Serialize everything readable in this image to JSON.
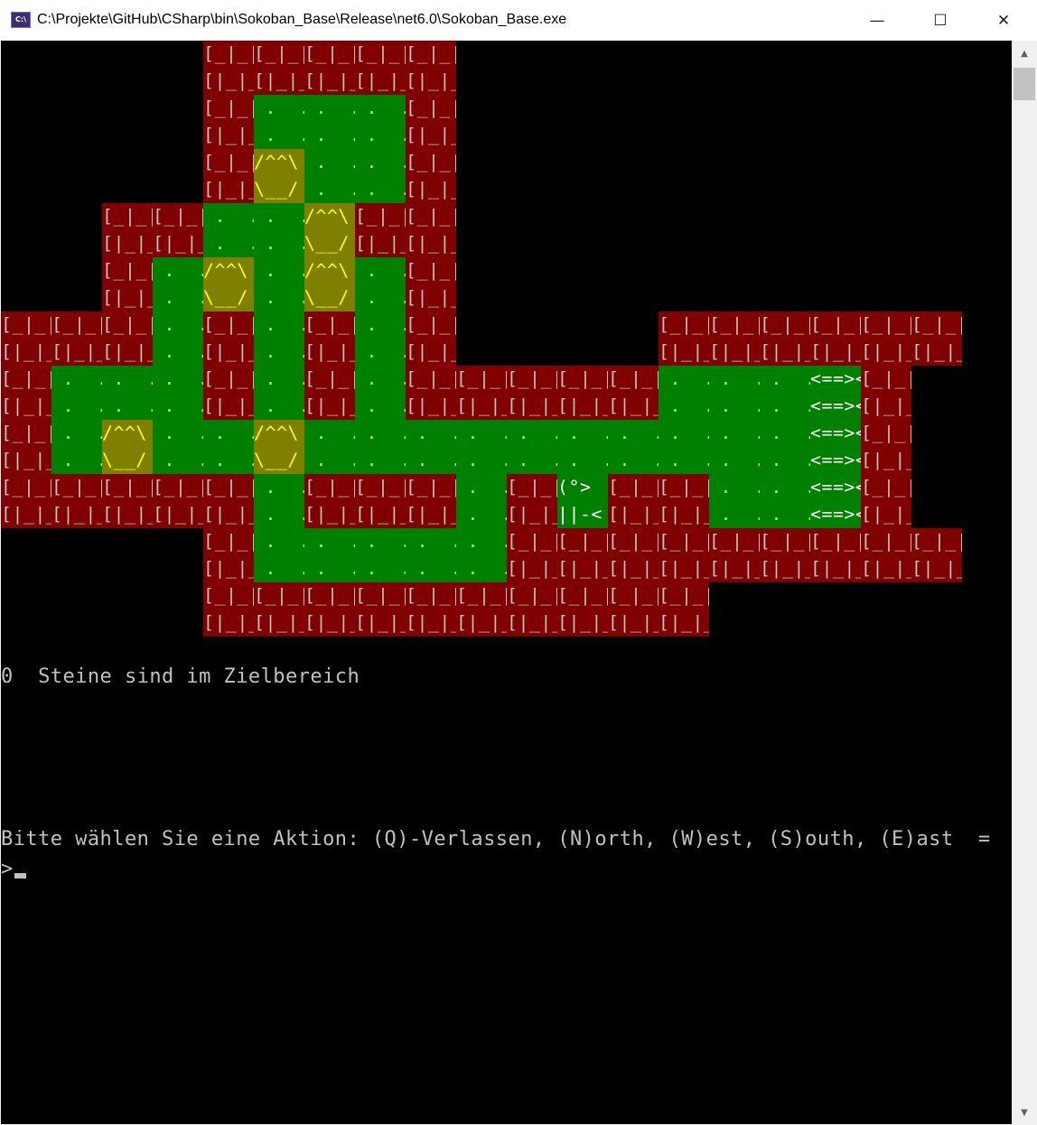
{
  "window": {
    "title": "C:\\Projekte\\GitHub\\CSharp\\bin\\Sokoban_Base\\Release\\net6.0\\Sokoban_Base.exe",
    "icon_text": "C:\\",
    "minimize_glyph": "—",
    "maximize_glyph": "☐",
    "close_glyph": "✕"
  },
  "colors": {
    "wall_bg": "#800000",
    "wall_fg": "#c0c0c0",
    "floor_bg": "#008000",
    "floor_fg": "#9af29a",
    "box_bg": "#808000",
    "box_fg": "#ffff00",
    "goal_fg": "#ffffff",
    "console_bg": "#000000",
    "console_fg": "#c0c0c0"
  },
  "tiles": {
    "W": [
      "[_|_|_|_|",
      "[|_|_|_|_"
    ],
    "F": [
      " .  .  .",
      " .  .  ."
    ],
    "B": [
      "/^^\\",
      "\\__/"
    ],
    "G": [
      "<==><==>",
      "<==><==>"
    ],
    "P": [
      "(°>",
      "||-<"
    ],
    "Q": [
      "/^^\\",
      "\\__/"
    ]
  },
  "map": [
    "    WWWWW         ",
    "    WFFFW         ",
    "    WBFFW         ",
    "  WWFFBWW         ",
    "  WFBFBFW         ",
    "WWWFWFWFW    WWWWWW",
    "WFFFWFWFWWWWWFFFGW",
    "WFBFFBFFFFFFFFFFGW",
    "WWWWWFWWWFWPWWFFGW",
    "    WFFFFFWWWWWWWWW",
    "    WWWWWWWWWW     "
  ],
  "status": "0  Steine sind im Zielbereich",
  "prompt": "Bitte wählen Sie eine Aktion: (Q)-Verlassen, (N)orth, (W)est, (S)outh, (E)ast  =",
  "input_prompt": ">",
  "scrollbar": {
    "up_glyph": "▲",
    "down_glyph": "▼"
  }
}
